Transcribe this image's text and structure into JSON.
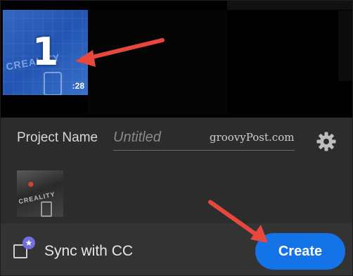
{
  "media": {
    "clip_index": "1",
    "clip_duration": ":28",
    "thumbnail_logo": "CREALITY"
  },
  "project": {
    "label": "Project Name",
    "placeholder": "Untitled",
    "settings_icon": "gear-icon"
  },
  "watermark": "groovyPost.com",
  "footer": {
    "sync_label": "Sync with CC",
    "cc_badge_icon": "star-icon",
    "create_label": "Create"
  },
  "colors": {
    "accent": "#1473e6",
    "annotation_arrow": "#e8473e",
    "panel_bg": "#2c2c2c",
    "footer_bg": "#333333",
    "cc_badge": "#6f6fe0"
  }
}
